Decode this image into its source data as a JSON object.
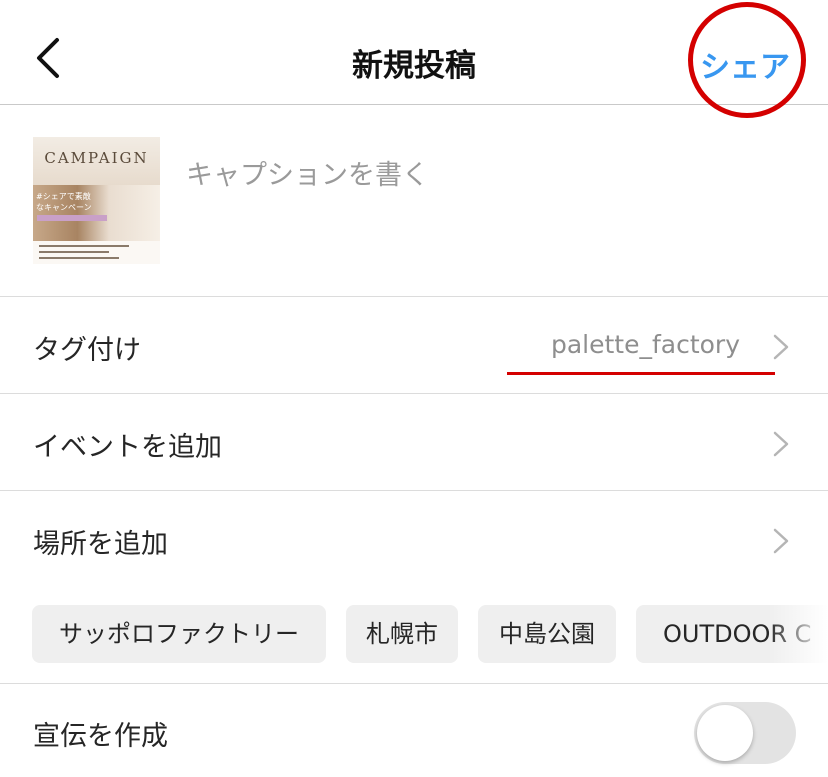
{
  "header": {
    "title": "新規投稿",
    "share_label": "シェア"
  },
  "post": {
    "caption_placeholder": "キャプションを書く",
    "thumbnail": {
      "campaign_text": "CAMPAIGN",
      "photo_text": "#シェアで素敵なキャンペーン"
    }
  },
  "rows": {
    "tag": {
      "label": "タグ付け",
      "value": "palette_factory"
    },
    "event": {
      "label": "イベントを追加"
    },
    "location": {
      "label": "場所を追加"
    }
  },
  "location_suggestions": [
    "サッポロファクトリー",
    "札幌市",
    "中島公園",
    "OUTDOOR C"
  ],
  "promotion": {
    "label": "宣伝を作成",
    "enabled": false
  },
  "colors": {
    "accent": "#3897f0",
    "annotation": "#d40000",
    "divider": "#dcdcdc",
    "chip_bg": "#efefef"
  },
  "icons": {
    "back": "chevron-left-icon",
    "row_arrow": "chevron-right-icon"
  }
}
